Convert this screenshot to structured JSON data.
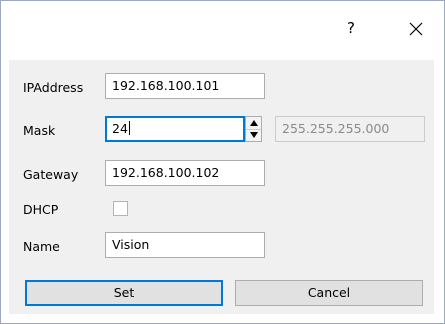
{
  "title_bar": {
    "help_label": "?",
    "close_icon": "close-icon"
  },
  "form": {
    "ip_address": {
      "label": "IPAddress",
      "value": "192.168.100.101"
    },
    "mask": {
      "label": "Mask",
      "value": "24",
      "derived_value": "255.255.255.000"
    },
    "gateway": {
      "label": "Gateway",
      "value": "192.168.100.102"
    },
    "dhcp": {
      "label": "DHCP",
      "checked": false
    },
    "name": {
      "label": "Name",
      "value": "Vision"
    }
  },
  "buttons": {
    "set_label": "Set",
    "cancel_label": "Cancel"
  },
  "colors": {
    "focus_accent": "#0078d7",
    "client_background": "#f0f0f0",
    "window_border": "#9aa9bd"
  }
}
